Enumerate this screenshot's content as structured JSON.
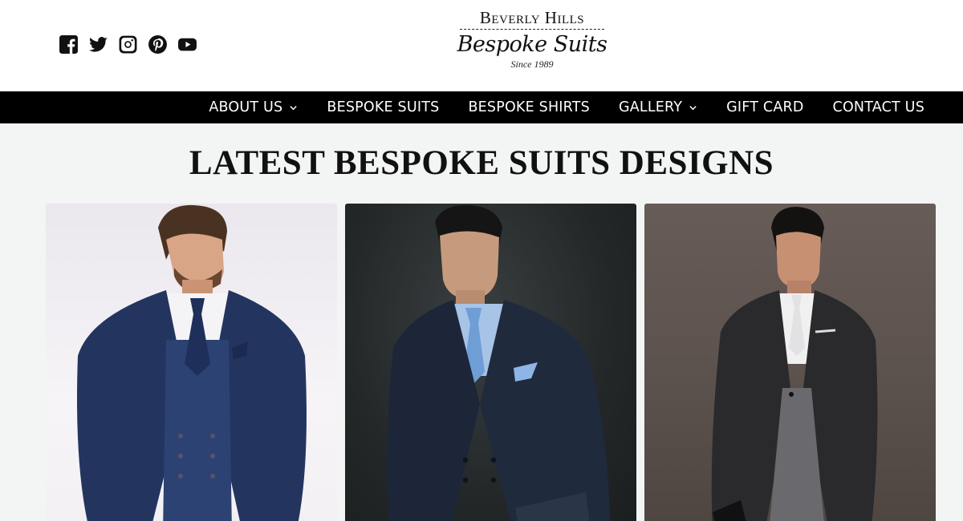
{
  "social": [
    {
      "name": "facebook-icon"
    },
    {
      "name": "twitter-icon"
    },
    {
      "name": "instagram-icon"
    },
    {
      "name": "pinterest-icon"
    },
    {
      "name": "youtube-icon"
    }
  ],
  "logo": {
    "top": "Beverly Hills",
    "main": "Bespoke Suits",
    "since": "Since 1989"
  },
  "nav": {
    "about": "ABOUT US",
    "suits": "BESPOKE SUITS",
    "shirts": "BESPOKE SHIRTS",
    "gallery": "GALLERY",
    "gift": "GIFT CARD",
    "contact": "CONTACT US"
  },
  "main": {
    "title": "LATEST BESPOKE SUITS DESIGNS"
  },
  "colors": {
    "header_bg": "#ffffff",
    "nav_bg": "#000000",
    "nav_text": "#ffffff",
    "page_bg": "#f3f4f4"
  },
  "cards": [
    {
      "name": "blue-three-piece-suit-photo"
    },
    {
      "name": "navy-double-breasted-suit-photo"
    },
    {
      "name": "charcoal-morning-coat-photo"
    }
  ]
}
